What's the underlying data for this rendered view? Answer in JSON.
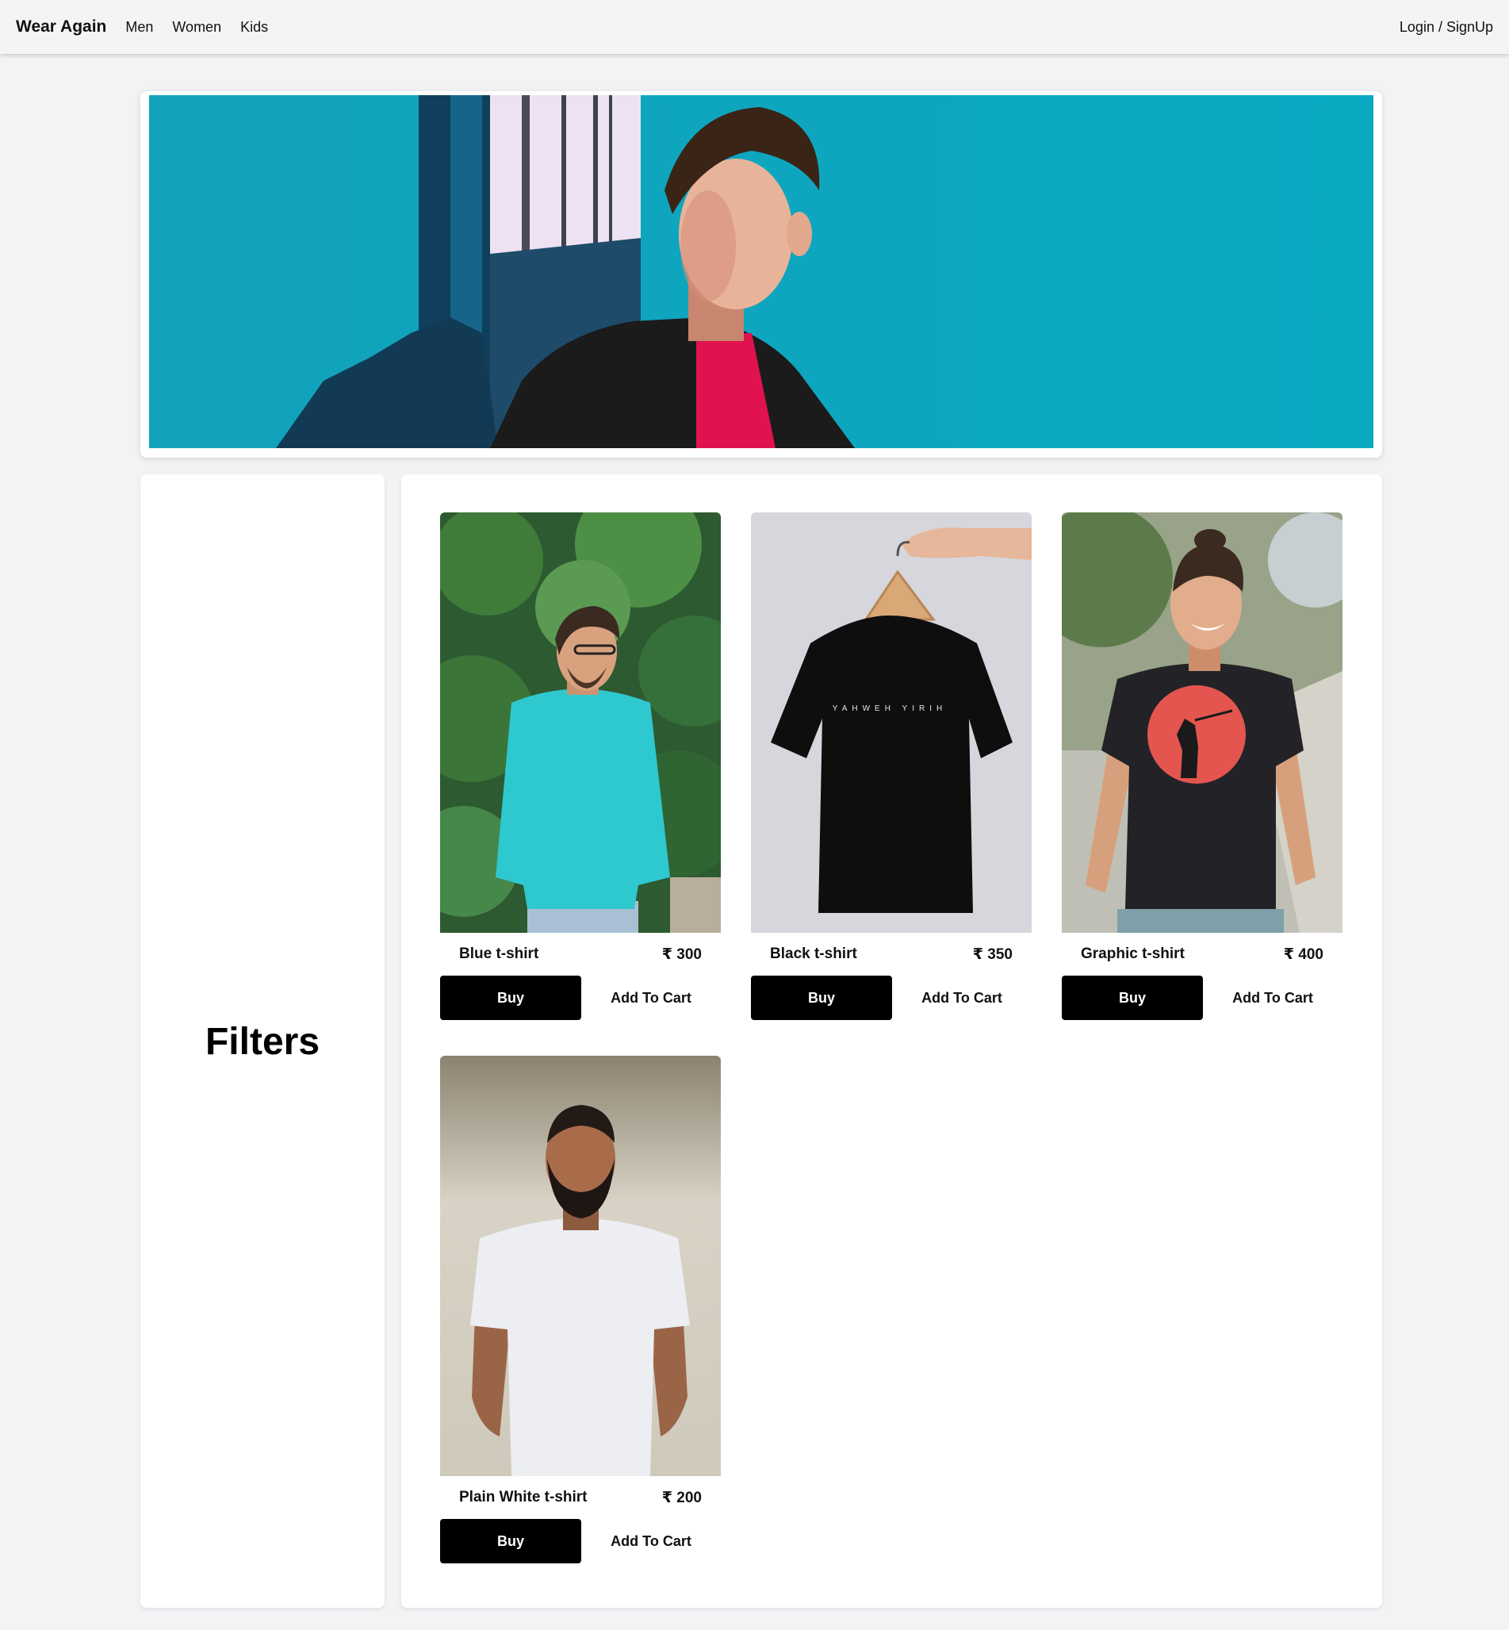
{
  "navbar": {
    "brand": "Wear Again",
    "links": [
      "Men",
      "Women",
      "Kids"
    ],
    "auth": "Login / SignUp"
  },
  "hero": {
    "image_icon": "hero-banner-image",
    "colors": {
      "wall": "#12a8bf",
      "jacket": "#1b1b1b",
      "shirt": "#e0124f"
    }
  },
  "filters": {
    "title": "Filters"
  },
  "products": [
    {
      "name": "Blue t-shirt",
      "price": "₹ 300",
      "buy": "Buy",
      "cart": "Add To Cart",
      "shirt_color": "#2ec8cf"
    },
    {
      "name": "Black t-shirt",
      "price": "₹ 350",
      "buy": "Buy",
      "cart": "Add To Cart",
      "shirt_color": "#0e0e0e"
    },
    {
      "name": "Graphic t-shirt",
      "price": "₹ 400",
      "buy": "Buy",
      "cart": "Add To Cart",
      "shirt_color": "#232327"
    },
    {
      "name": "Plain White t-shirt",
      "price": "₹ 200",
      "buy": "Buy",
      "cart": "Add To Cart",
      "shirt_color": "#eceef2"
    }
  ]
}
